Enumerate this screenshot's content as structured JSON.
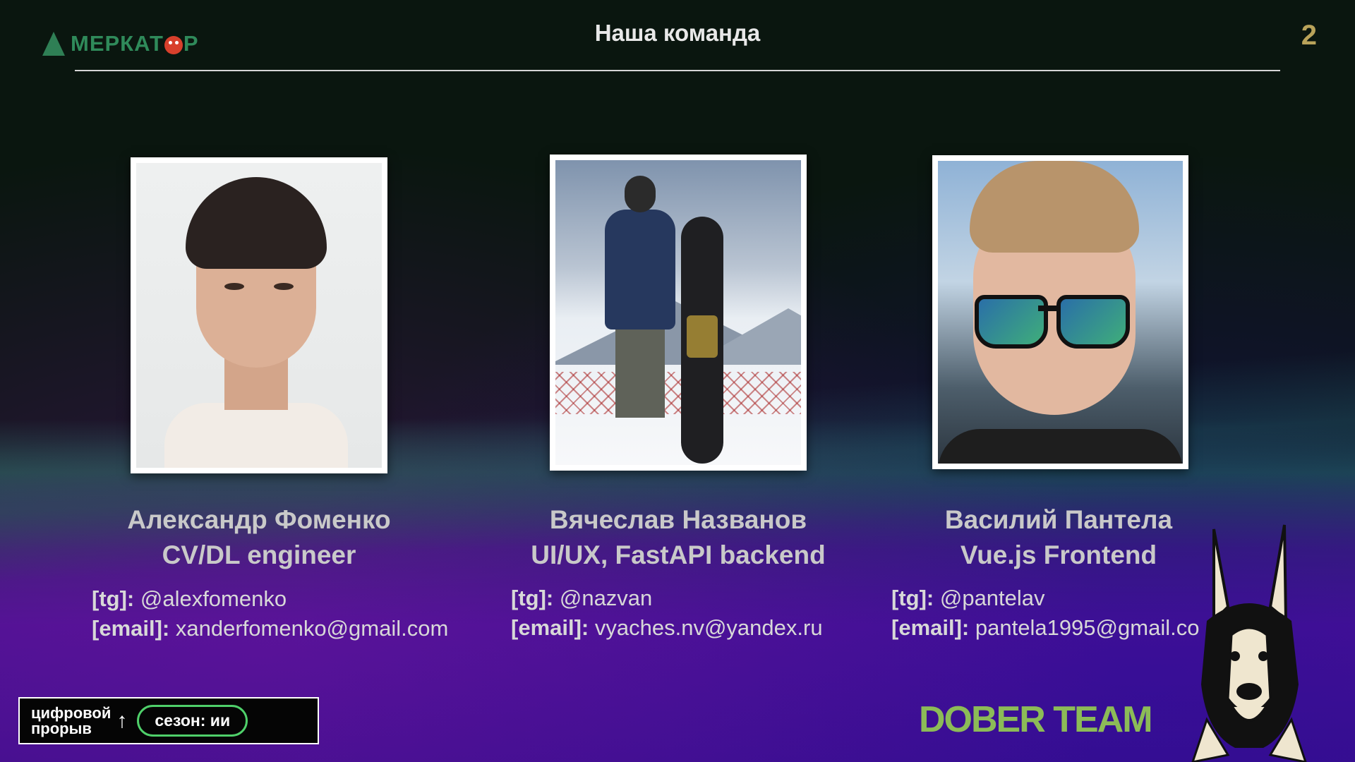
{
  "header": {
    "logo_text": "МЕРКАТ",
    "logo_suffix": "Р",
    "title": "Наша команда",
    "page_number": "2"
  },
  "members": [
    {
      "name": "Александр Фоменко",
      "role": "CV/DL engineer",
      "tg_label": "[tg]:",
      "tg": "@alexfomenko",
      "email_label": "[email]:",
      "email": "xanderfomenko@gmail.com"
    },
    {
      "name": "Вячеслав Названов",
      "role": "UI/UX, FastAPI backend",
      "tg_label": "[tg]:",
      "tg": "@nazvan",
      "email_label": "[email]:",
      "email": "vyaches.nv@yandex.ru"
    },
    {
      "name": "Василий Пантела",
      "role": "Vue.js Frontend",
      "tg_label": "[tg]:",
      "tg": "@pantelav",
      "email_label": "[email]:",
      "email": "pantela1995@gmail.co"
    }
  ],
  "footer": {
    "hackathon_line1": "цифровой",
    "hackathon_line2": "прорыв",
    "season": "сезон: ии",
    "team_name": "DOBER TEAM"
  },
  "colors": {
    "team_name": "#8cbb57",
    "season_border": "#4fd06a",
    "page_number": "#b9a35a",
    "logo": "#2f8a5a"
  }
}
